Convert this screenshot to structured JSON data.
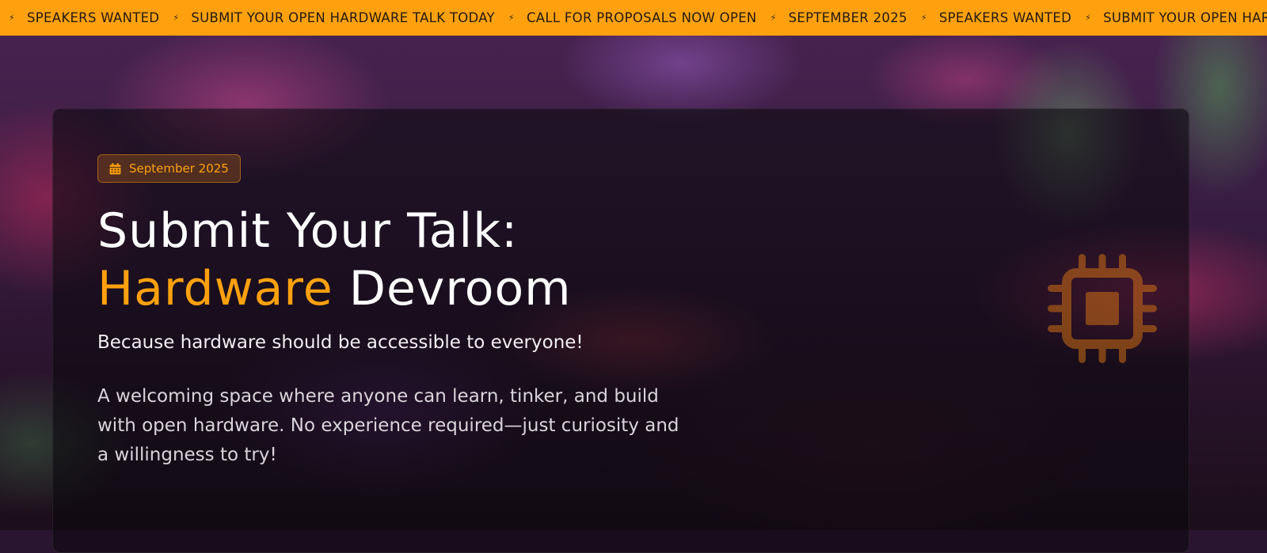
{
  "ticker": {
    "items": [
      {
        "icon": "bolt-icon",
        "label": "SPEAKERS WANTED"
      },
      {
        "icon": "bolt-icon",
        "label": "SUBMIT YOUR OPEN HARDWARE TALK TODAY"
      },
      {
        "icon": "bolt-icon",
        "label": "CALL FOR PROPOSALS NOW OPEN"
      },
      {
        "icon": "bolt-icon",
        "label": "SEPTEMBER 2025"
      },
      {
        "icon": "bolt-icon",
        "label": "SPEAKERS WANTED"
      },
      {
        "icon": "bolt-icon",
        "label": "SUBMIT YOUR OPEN HARDWARE TALK TODAY"
      }
    ],
    "bolt_glyph": "⚡",
    "background": "#ffa10f"
  },
  "hero": {
    "badge": {
      "icon": "calendar-icon",
      "label": "September 2025"
    },
    "title_line1": "Submit Your Talk:",
    "title_accent": "Hardware",
    "title_rest": " Devroom",
    "tagline": "Because hardware should be accessible to everyone!",
    "description": "A welcoming space where anyone can learn, tinker, and build with open hardware. No experience required—just curiosity and a willingness to try!",
    "decor_icon": "chip-icon"
  },
  "colors": {
    "accent": "#ffa10f",
    "text": "#ffffff"
  }
}
